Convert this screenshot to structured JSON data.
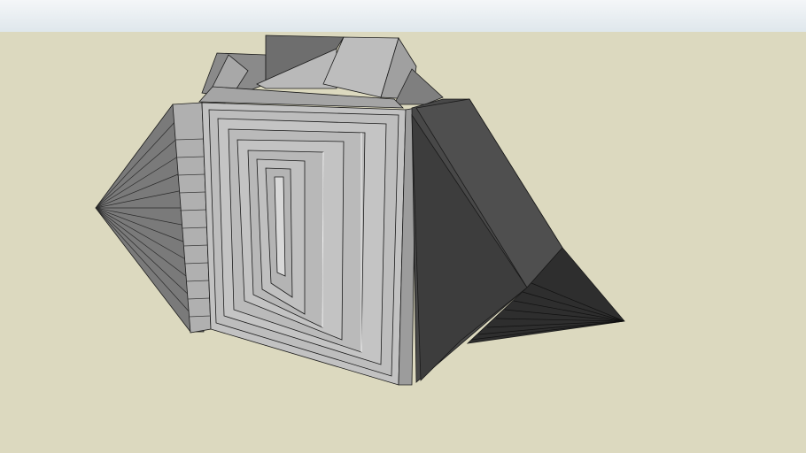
{
  "scene": {
    "sky_color_top": "#f4f6f8",
    "sky_color_bottom": "#dfe7ec",
    "ground_color": "#dcd9bf",
    "edge_color": "#1a1a1a"
  },
  "model": {
    "shades": {
      "light": "#c4c4c4",
      "mid": "#a3a3a3",
      "dark": "#6a6a6a",
      "darker": "#4d4d4d",
      "darkest": "#3a3a3a"
    }
  }
}
